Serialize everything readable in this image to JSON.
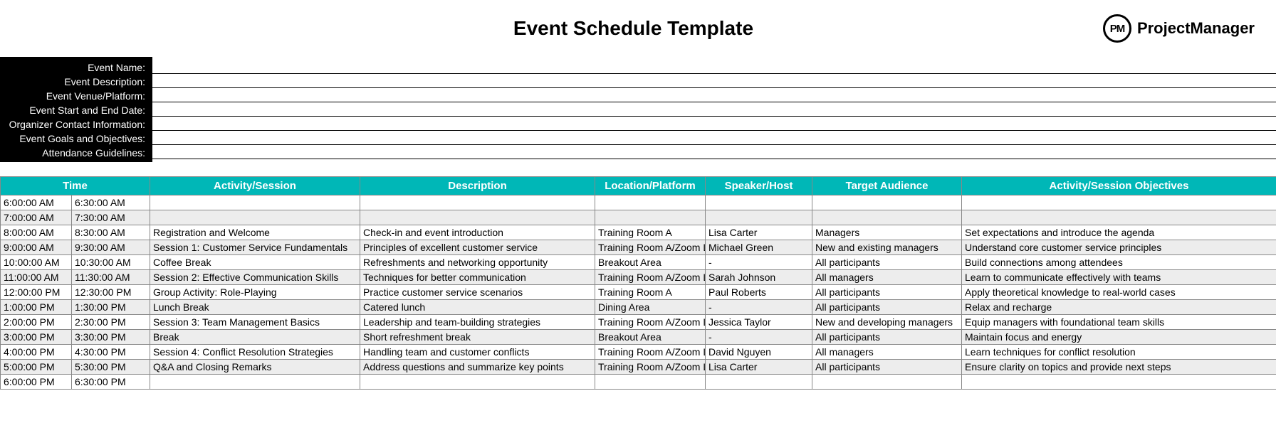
{
  "title": "Event Schedule Template",
  "brand": "ProjectManager",
  "brand_initials": "PM",
  "info_fields": [
    {
      "label": "Event Name:",
      "value": ""
    },
    {
      "label": "Event Description:",
      "value": ""
    },
    {
      "label": "Event Venue/Platform:",
      "value": ""
    },
    {
      "label": "Event Start and End Date:",
      "value": ""
    },
    {
      "label": "Organizer Contact Information:",
      "value": ""
    },
    {
      "label": "Event Goals and Objectives:",
      "value": ""
    },
    {
      "label": "Attendance Guidelines:",
      "value": ""
    }
  ],
  "columns": {
    "time": "Time",
    "activity": "Activity/Session",
    "description": "Description",
    "location": "Location/Platform",
    "speaker": "Speaker/Host",
    "target": "Target Audience",
    "objectives": "Activity/Session Objectives"
  },
  "rows": [
    {
      "start": "6:00:00 AM",
      "end": "6:30:00 AM",
      "activity": "",
      "description": "",
      "location": "",
      "speaker": "",
      "target": "",
      "objectives": ""
    },
    {
      "start": "7:00:00 AM",
      "end": "7:30:00 AM",
      "activity": "",
      "description": "",
      "location": "",
      "speaker": "",
      "target": "",
      "objectives": ""
    },
    {
      "start": "8:00:00 AM",
      "end": "8:30:00 AM",
      "activity": "Registration and Welcome",
      "description": "Check-in and event introduction",
      "location": "Training Room A",
      "speaker": "Lisa Carter",
      "target": "Managers",
      "objectives": "Set expectations and introduce the agenda"
    },
    {
      "start": "9:00:00 AM",
      "end": "9:30:00 AM",
      "activity": "Session 1: Customer Service Fundamentals",
      "description": "Principles of excellent customer service",
      "location": "Training Room A/Zoom Link",
      "speaker": "Michael Green",
      "target": "New and existing managers",
      "objectives": "Understand core customer service principles"
    },
    {
      "start": "10:00:00 AM",
      "end": "10:30:00 AM",
      "activity": "Coffee Break",
      "description": "Refreshments and networking opportunity",
      "location": "Breakout Area",
      "speaker": "-",
      "target": "All participants",
      "objectives": "Build connections among attendees"
    },
    {
      "start": "11:00:00 AM",
      "end": "11:30:00 AM",
      "activity": "Session 2: Effective Communication Skills",
      "description": "Techniques for better communication",
      "location": "Training Room A/Zoom Link",
      "speaker": "Sarah Johnson",
      "target": "All managers",
      "objectives": "Learn to communicate effectively with teams"
    },
    {
      "start": "12:00:00 PM",
      "end": "12:30:00 PM",
      "activity": "Group Activity: Role-Playing",
      "description": "Practice customer service scenarios",
      "location": "Training Room A",
      "speaker": "Paul Roberts",
      "target": "All participants",
      "objectives": "Apply theoretical knowledge to real-world cases"
    },
    {
      "start": "1:00:00 PM",
      "end": "1:30:00 PM",
      "activity": "Lunch Break",
      "description": "Catered lunch",
      "location": "Dining Area",
      "speaker": "-",
      "target": "All participants",
      "objectives": "Relax and recharge"
    },
    {
      "start": "2:00:00 PM",
      "end": "2:30:00 PM",
      "activity": "Session 3: Team Management Basics",
      "description": "Leadership and team-building strategies",
      "location": "Training Room A/Zoom Link",
      "speaker": "Jessica Taylor",
      "target": "New and developing managers",
      "objectives": "Equip managers with foundational team skills"
    },
    {
      "start": "3:00:00 PM",
      "end": "3:30:00 PM",
      "activity": "Break",
      "description": "Short refreshment break",
      "location": "Breakout Area",
      "speaker": "-",
      "target": "All participants",
      "objectives": "Maintain focus and energy"
    },
    {
      "start": "4:00:00 PM",
      "end": "4:30:00 PM",
      "activity": "Session 4: Conflict Resolution Strategies",
      "description": "Handling team and customer conflicts",
      "location": "Training Room A/Zoom Link",
      "speaker": "David Nguyen",
      "target": "All managers",
      "objectives": "Learn techniques for conflict resolution"
    },
    {
      "start": "5:00:00 PM",
      "end": "5:30:00 PM",
      "activity": "Q&A and Closing Remarks",
      "description": "Address questions and summarize key points",
      "location": "Training Room A/Zoom Link",
      "speaker": "Lisa Carter",
      "target": "All participants",
      "objectives": "Ensure clarity on topics and provide next steps"
    },
    {
      "start": "6:00:00 PM",
      "end": "6:30:00 PM",
      "activity": "",
      "description": "",
      "location": "",
      "speaker": "",
      "target": "",
      "objectives": ""
    }
  ]
}
